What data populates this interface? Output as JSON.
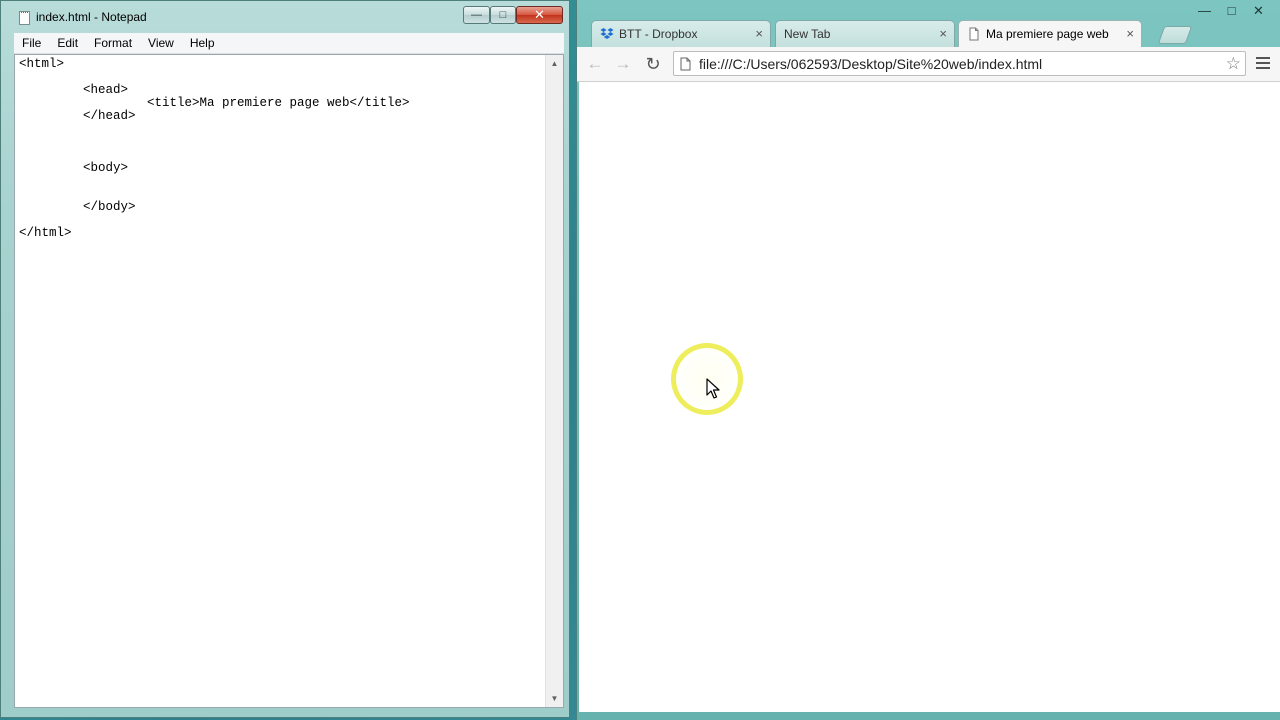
{
  "notepad": {
    "title": "index.html - Notepad",
    "controls": {
      "minimize": "—",
      "maximize": "□",
      "close": "✕"
    },
    "menu": [
      "File",
      "Edit",
      "Format",
      "View",
      "Help"
    ],
    "code": {
      "line1": "<html>",
      "line2": "<head>",
      "line3": "<title>Ma premiere page web</title>",
      "line4": "</head>",
      "line5": "<body>",
      "line6": "</body>",
      "line7": "</html>"
    }
  },
  "browser": {
    "controls": {
      "minimize": "—",
      "maximize": "□",
      "close": "✕"
    },
    "tabs": [
      {
        "label": "BTT - Dropbox",
        "icon": "dropbox-icon",
        "active": false
      },
      {
        "label": "New Tab",
        "icon": "",
        "active": false
      },
      {
        "label": "Ma premiere page web",
        "icon": "page-icon",
        "active": true
      }
    ],
    "tab_close": "×",
    "address": "file:///C:/Users/062593/Desktop/Site%20web/index.html",
    "nav": {
      "back": "←",
      "forward": "→",
      "reload": "↻",
      "star": "☆"
    }
  },
  "colors": {
    "dropbox_blue": "#1f6fd1",
    "close_red": "#c3321a",
    "cursor_highlight": "#e8e828"
  }
}
